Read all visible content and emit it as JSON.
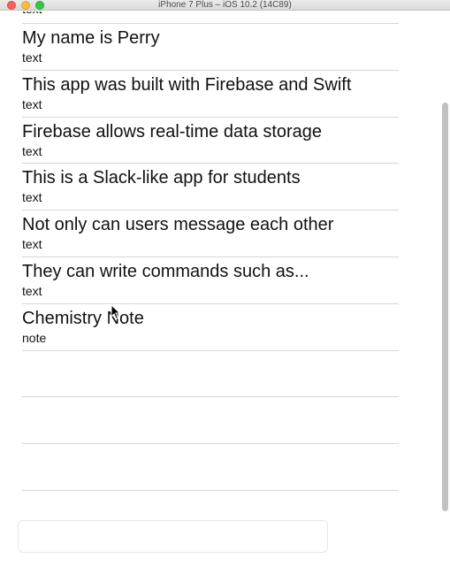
{
  "window": {
    "title": "iPhone 7 Plus – iOS 10.2 (14C89)"
  },
  "messages": [
    {
      "title": "",
      "subtitle": "text"
    },
    {
      "title": "My name is Perry",
      "subtitle": "text"
    },
    {
      "title": "This app was built with Firebase and Swift",
      "subtitle": "text"
    },
    {
      "title": "Firebase allows real-time data storage",
      "subtitle": "text"
    },
    {
      "title": "This is a Slack-like app for students",
      "subtitle": "text"
    },
    {
      "title": "Not only can users message each other",
      "subtitle": "text"
    },
    {
      "title": "They can write commands such as...",
      "subtitle": "text"
    },
    {
      "title": "Chemistry Note",
      "subtitle": "note"
    }
  ],
  "message_input": {
    "value": "",
    "placeholder": ""
  }
}
